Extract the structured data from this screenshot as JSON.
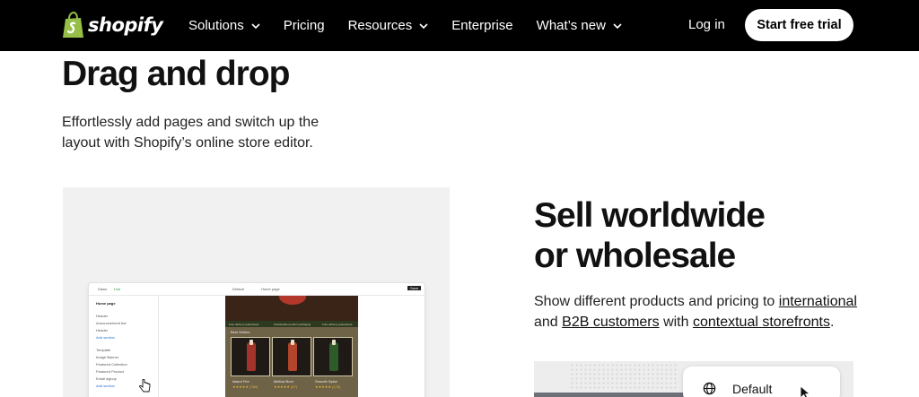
{
  "nav": {
    "logo_text": "shopify",
    "links": [
      {
        "label": "Solutions",
        "dropdown": true
      },
      {
        "label": "Pricing",
        "dropdown": false
      },
      {
        "label": "Resources",
        "dropdown": true
      },
      {
        "label": "Enterprise",
        "dropdown": false
      },
      {
        "label": "What’s new",
        "dropdown": true
      }
    ],
    "login": "Log in",
    "cta": "Start free trial"
  },
  "drag_section": {
    "title": "Drag and drop",
    "description": "Effortlessly add pages and switch up the layout with Shopify’s online store editor."
  },
  "editor_mock": {
    "store_name": "Dawn",
    "status": "Live",
    "theme_select": "Default",
    "page_select": "Home page",
    "save": "Save",
    "sidebar_title": "Home page",
    "sidebar_items": [
      "Header",
      "Announcement bar",
      "Header",
      "Add section",
      "Template",
      "Image Banner",
      "Featured Collection",
      "Featured Product",
      "Email signup",
      "Add section"
    ],
    "banner_texts": [
      "Free delivery guaranteed",
      "Sustainable product packaging",
      "Free delivery guaranteed"
    ],
    "section_heading": "Best Sellers",
    "products": [
      {
        "name": "Island Fire",
        "rating": "★★★★★ (780)",
        "bottle_color": "#a3342a"
      },
      {
        "name": "Mellow Burn",
        "rating": "★★★★★ (67)",
        "bottle_color": "#b2452c"
      },
      {
        "name": "Smooth Spice",
        "rating": "★★★★★ (178)",
        "bottle_color": "#2f5a2a"
      }
    ]
  },
  "sell_section": {
    "title_line1": "Sell worldwide",
    "title_line2": "or wholesale",
    "desc_part1": "Show different products and pricing to ",
    "link_international": "international",
    "desc_part2": " and ",
    "link_b2b": "B2B customers",
    "desc_part3": " with ",
    "link_storefronts": "contextual storefronts",
    "desc_part4": "."
  },
  "market_dropdown": {
    "label": "Default",
    "icon": "globe-icon"
  },
  "colors": {
    "nav_bg": "#000000",
    "brand_green": "#95bf47"
  }
}
